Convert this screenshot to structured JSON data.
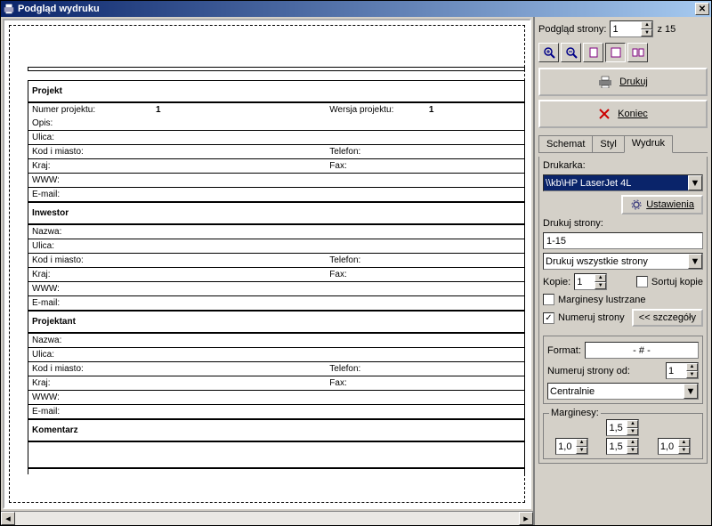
{
  "window": {
    "title": "Podgląd wydruku"
  },
  "preview": {
    "page_label": "Podgląd strony:",
    "page_current": "1",
    "page_total_prefix": "z",
    "page_total": "15"
  },
  "buttons": {
    "print": "Drukuj",
    "close": "Koniec",
    "settings": "Ustawienia",
    "details": "<< szczegóły"
  },
  "tabs": {
    "schema": "Schemat",
    "style": "Styl",
    "print": "Wydruk"
  },
  "printcfg": {
    "printer_label": "Drukarka:",
    "printer_value": "\\\\kb\\HP LaserJet 4L",
    "pages_label": "Drukuj strony:",
    "pages_value": "1-15",
    "range_mode": "Drukuj wszystkie strony",
    "copies_label": "Kopie:",
    "copies_value": "1",
    "collate_label": "Sortuj kopie",
    "mirror_label": "Marginesy lustrzane",
    "number_label": "Numeruj strony",
    "format_label": "Format:",
    "format_value": "- # -",
    "start_label": "Numeruj strony od:",
    "start_value": "1",
    "align": "Centralnie",
    "margins_label": "Marginesy:",
    "m_top": "1,5",
    "m_left": "1,0",
    "m_bottom": "1,5",
    "m_right": "1,0"
  },
  "report": {
    "s1": "Projekt",
    "s2": "Inwestor",
    "s3": "Projektant",
    "s4": "Komentarz",
    "num_projektu": "Numer projektu:",
    "num_val": "1",
    "wersja": "Wersja projektu:",
    "wersja_val": "1",
    "opis": "Opis:",
    "ulica": "Ulica:",
    "kod": "Kod i miasto:",
    "kraj": "Kraj:",
    "www": "WWW:",
    "email": "E-mail:",
    "nazwa": "Nazwa:",
    "telefon": "Telefon:",
    "fax": "Fax:"
  }
}
